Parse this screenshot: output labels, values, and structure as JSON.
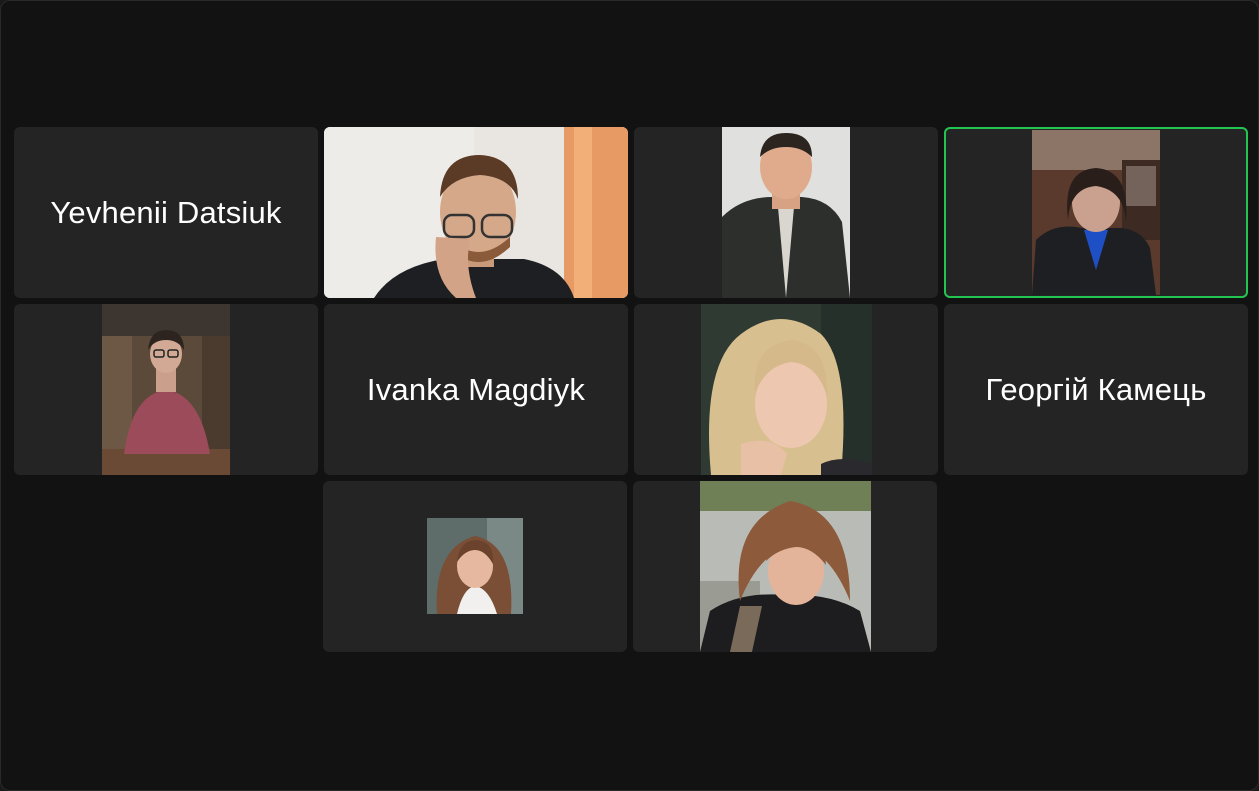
{
  "meeting": {
    "participants": [
      {
        "name": "Yevhenii Datsiuk",
        "video": false
      },
      {
        "name": "",
        "video": true
      },
      {
        "name": "",
        "video": true
      },
      {
        "name": "",
        "video": true,
        "active_speaker": true
      },
      {
        "name": "",
        "video": true
      },
      {
        "name": "Ivanka Magdiyk",
        "video": false
      },
      {
        "name": "",
        "video": true
      },
      {
        "name": "Георгій Камець",
        "video": false
      },
      {
        "name": "",
        "video": true
      },
      {
        "name": "",
        "video": true
      }
    ]
  },
  "colors": {
    "window_bg": "#121212",
    "tile_bg": "#242424",
    "active_speaker_border": "#23c552",
    "name_text": "#ffffff"
  }
}
